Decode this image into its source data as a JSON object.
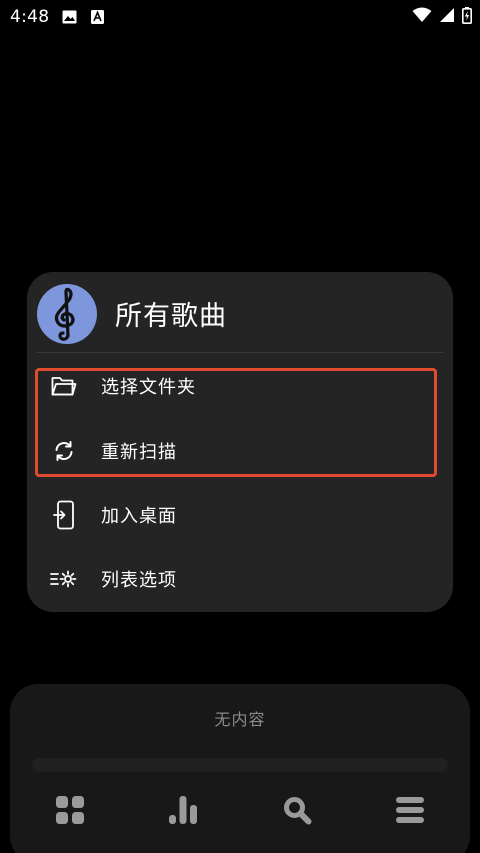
{
  "status_bar": {
    "time": "4:48",
    "left_icons": [
      "image-icon",
      "text-a-icon"
    ],
    "right_icons": [
      "wifi-icon",
      "cellular-signal-icon",
      "battery-charging-icon"
    ]
  },
  "menu": {
    "title": "所有歌曲",
    "avatar_icon": "treble-clef-icon",
    "items": [
      {
        "label": "选择文件夹",
        "icon": "folder-icon"
      },
      {
        "label": "重新扫描",
        "icon": "refresh-icon"
      },
      {
        "label": "加入桌面",
        "icon": "add-to-home-icon"
      },
      {
        "label": "列表选项",
        "icon": "list-settings-icon"
      }
    ],
    "highlight_color": "#e04a2f"
  },
  "player": {
    "empty_text": "无内容"
  },
  "bottom_nav": {
    "items": [
      {
        "icon": "grid-icon"
      },
      {
        "icon": "bar-chart-icon"
      },
      {
        "icon": "search-icon"
      },
      {
        "icon": "menu-icon"
      }
    ]
  },
  "colors": {
    "background": "#000000",
    "card": "#242424",
    "avatar": "#7e96db",
    "panel": "#181818",
    "muted_text": "#8a8a8a",
    "nav_icon": "#9a9a9a"
  }
}
